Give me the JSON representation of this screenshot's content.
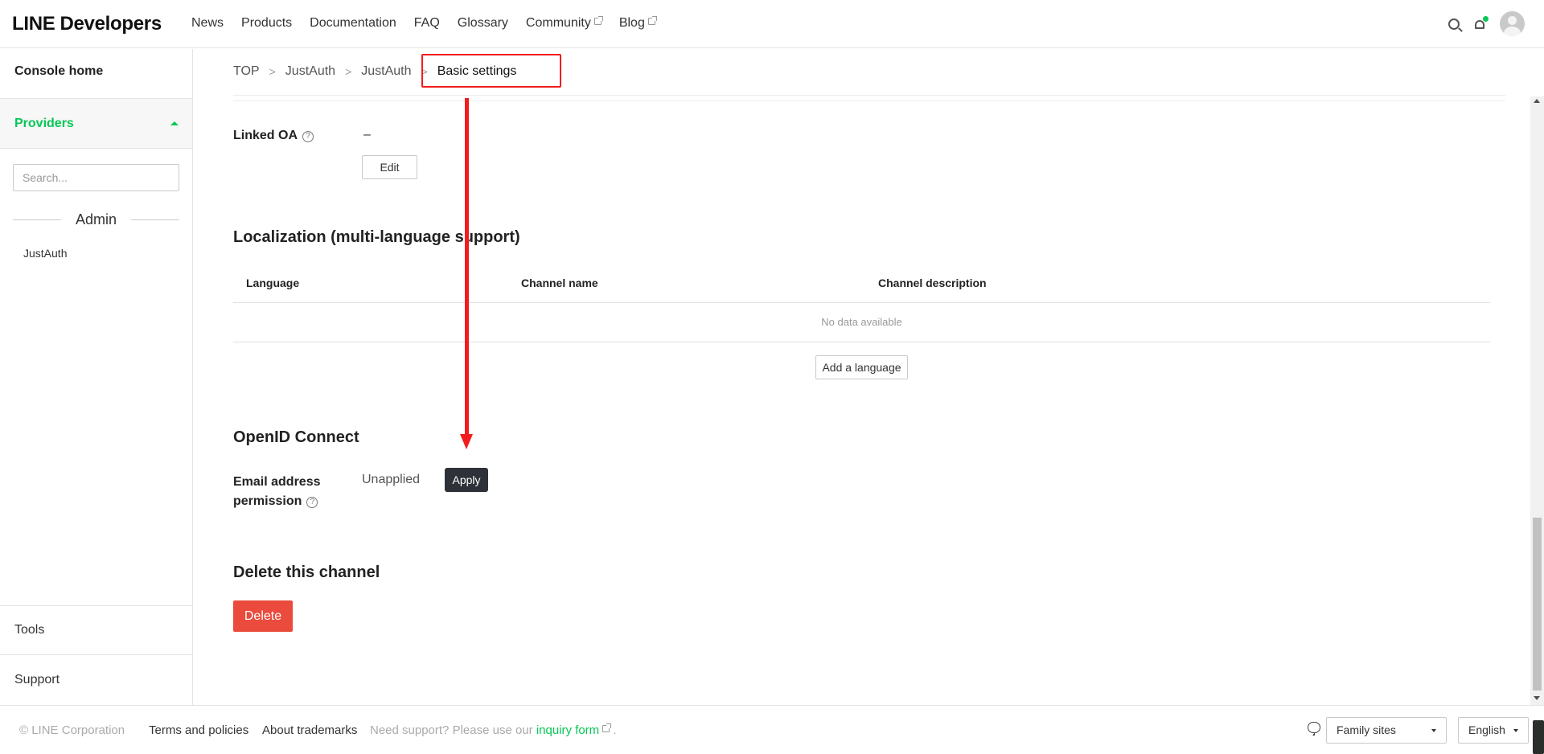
{
  "header": {
    "logo_line": "LINE",
    "logo_dev": "Developers",
    "nav": [
      {
        "label": "News",
        "external": false
      },
      {
        "label": "Products",
        "external": false
      },
      {
        "label": "Documentation",
        "external": false
      },
      {
        "label": "FAQ",
        "external": false
      },
      {
        "label": "Glossary",
        "external": false
      },
      {
        "label": "Community",
        "external": true
      },
      {
        "label": "Blog",
        "external": true
      }
    ]
  },
  "sidebar": {
    "console_home": "Console home",
    "providers": "Providers",
    "search_placeholder": "Search...",
    "section": "Admin",
    "items": [
      "JustAuth"
    ],
    "tools": "Tools",
    "support": "Support"
  },
  "breadcrumb": [
    "TOP",
    "JustAuth",
    "JustAuth",
    "Basic settings"
  ],
  "linked_oa": {
    "label": "Linked OA",
    "value": "–",
    "edit_label": "Edit"
  },
  "localization": {
    "title": "Localization (multi-language support)",
    "columns": [
      "Language",
      "Channel name",
      "Channel description"
    ],
    "empty_text": "No data available",
    "add_label": "Add a language"
  },
  "openid": {
    "title": "OpenID Connect",
    "email_label_1": "Email address",
    "email_label_2": "permission",
    "status": "Unapplied",
    "apply_label": "Apply"
  },
  "delete_section": {
    "title": "Delete this channel",
    "button": "Delete"
  },
  "footer": {
    "copyright": "© LINE Corporation",
    "terms": "Terms and policies",
    "trademarks": "About trademarks",
    "support_text": "Need support? Please use our",
    "support_link": "inquiry form",
    "support_end": ".",
    "family_sites": "Family sites",
    "language": "English"
  },
  "colors": {
    "brand_green": "#06c755",
    "annotation_red": "#f31c1c",
    "delete_red": "#ea4b3c",
    "dark_button": "#2e3138"
  }
}
